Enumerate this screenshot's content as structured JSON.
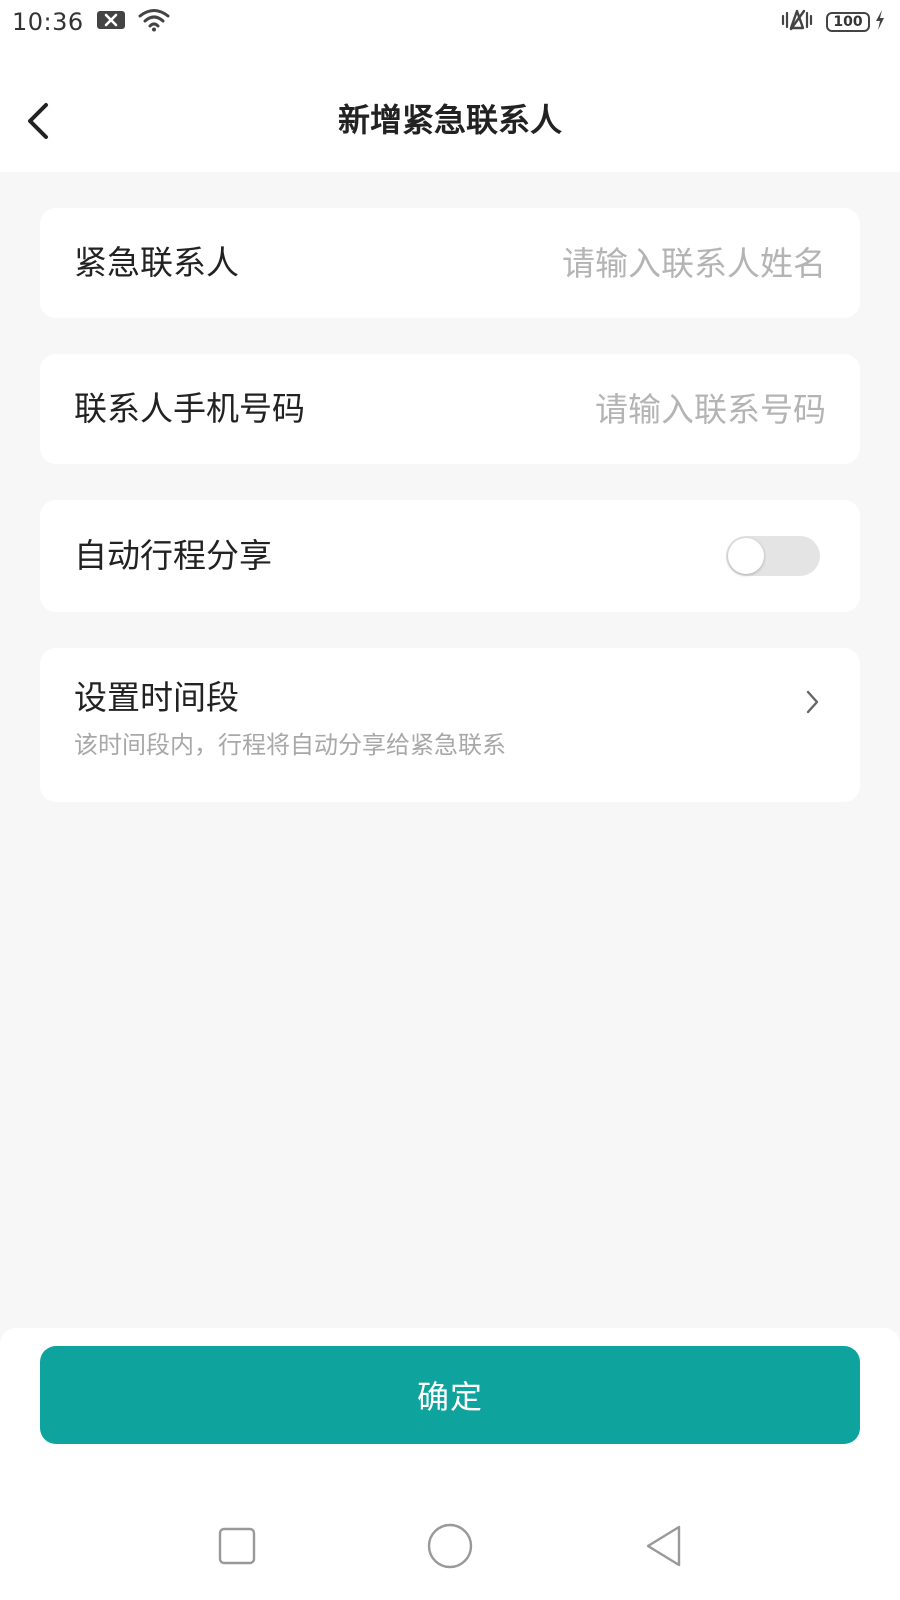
{
  "status_bar": {
    "time": "10:36",
    "battery": "100"
  },
  "header": {
    "title": "新增紧急联系人"
  },
  "form": {
    "contact_name": {
      "label": "紧急联系人",
      "placeholder": "请输入联系人姓名",
      "value": ""
    },
    "contact_phone": {
      "label": "联系人手机号码",
      "placeholder": "请输入联系号码",
      "value": ""
    },
    "auto_share": {
      "label": "自动行程分享",
      "enabled": false
    },
    "time_period": {
      "label": "设置时间段",
      "description": "该时间段内，行程将自动分享给紧急联系"
    }
  },
  "confirm_button": {
    "label": "确定"
  },
  "colors": {
    "accent": "#0fa39e",
    "background": "#f7f7f7",
    "card": "#ffffff",
    "placeholder": "#b4b4b4",
    "subtext": "#a8a8a8"
  },
  "icons": {
    "status": [
      "notification-x-icon",
      "wifi-icon",
      "vibrate-icon",
      "battery-icon",
      "charging-icon"
    ],
    "header": [
      "back-arrow-icon"
    ],
    "row": [
      "chevron-right-icon"
    ],
    "nav": [
      "recent-apps-icon",
      "home-icon",
      "back-triangle-icon"
    ]
  }
}
